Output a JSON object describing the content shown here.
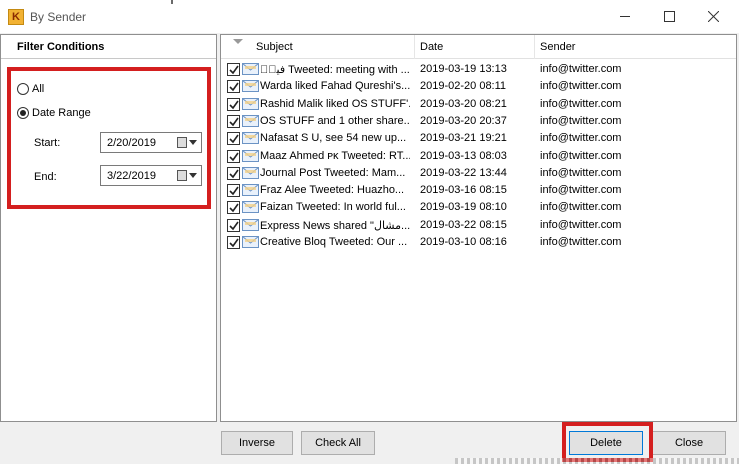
{
  "window": {
    "title": "By Sender",
    "app_icon_letter": "K"
  },
  "filter": {
    "header": "Filter Conditions",
    "all_label": "All",
    "date_range_label": "Date Range",
    "selected": "Date Range",
    "start_label": "Start:",
    "start_value": "2/20/2019",
    "end_label": "End:",
    "end_value": "3/22/2019"
  },
  "list": {
    "columns": {
      "subject": "Subject",
      "date": "Date",
      "sender": "Sender"
    },
    "rows": [
      {
        "subject": "فیضؔ Tweeted: meeting with ...",
        "date": "2019-03-19 13:13",
        "sender": "info@twitter.com",
        "checked": true
      },
      {
        "subject": "Warda liked Fahad Qureshi's...",
        "date": "2019-02-20 08:11",
        "sender": "info@twitter.com",
        "checked": true
      },
      {
        "subject": "Rashid Malik liked OS STUFF'...",
        "date": "2019-03-20 08:21",
        "sender": "info@twitter.com",
        "checked": true
      },
      {
        "subject": "OS STUFF and 1 other share...",
        "date": "2019-03-20 20:37",
        "sender": "info@twitter.com",
        "checked": true
      },
      {
        "subject": "Nafasat S U, see 54 new up...",
        "date": "2019-03-21 19:21",
        "sender": "info@twitter.com",
        "checked": true
      },
      {
        "subject": "Maaz Ahmed ᴘᴋ Tweeted: RT...",
        "date": "2019-03-13 08:03",
        "sender": "info@twitter.com",
        "checked": true
      },
      {
        "subject": "Journal Post Tweeted: Mam...",
        "date": "2019-03-22 13:44",
        "sender": "info@twitter.com",
        "checked": true
      },
      {
        "subject": "Fraz Alee Tweeted: Huazho...",
        "date": "2019-03-16 08:15",
        "sender": "info@twitter.com",
        "checked": true
      },
      {
        "subject": "Faizan Tweeted: In world ful...",
        "date": "2019-03-19 08:10",
        "sender": "info@twitter.com",
        "checked": true
      },
      {
        "subject": "Express News shared \"مشال...",
        "date": "2019-03-22 08:15",
        "sender": "info@twitter.com",
        "checked": true
      },
      {
        "subject": "Creative Bloq Tweeted: Our ...",
        "date": "2019-03-10 08:16",
        "sender": "info@twitter.com",
        "checked": true
      }
    ]
  },
  "buttons": {
    "inverse": "Inverse",
    "check_all": "Check All",
    "delete": "Delete",
    "close": "Close"
  },
  "colors": {
    "highlight": "#d41f1f",
    "panel_bg": "#f0f0f0",
    "button_bg": "#e1e1e1"
  }
}
